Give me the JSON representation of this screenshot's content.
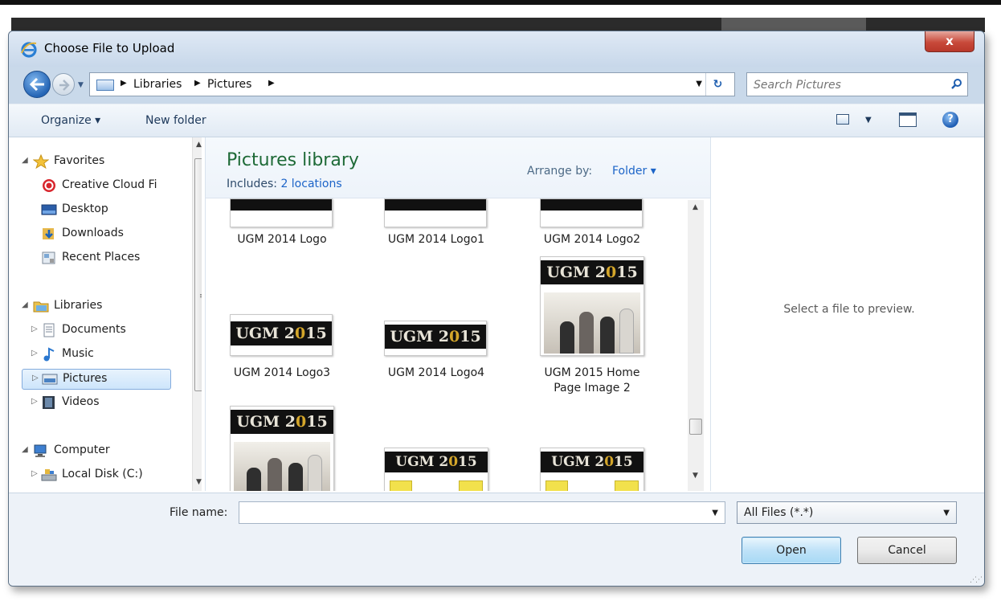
{
  "window": {
    "title": "Choose File to Upload",
    "close_label": "x"
  },
  "address": {
    "crumbs": [
      "Libraries",
      "Pictures"
    ]
  },
  "search": {
    "placeholder": "Search Pictures"
  },
  "toolbar": {
    "organize_label": "Organize ▾",
    "new_folder_label": "New folder"
  },
  "sidebar": {
    "favorites": {
      "label": "Favorites",
      "items": [
        "Creative Cloud Fi",
        "Desktop",
        "Downloads",
        "Recent Places"
      ]
    },
    "libraries": {
      "label": "Libraries",
      "items": [
        "Documents",
        "Music",
        "Pictures",
        "Videos"
      ],
      "selected": "Pictures"
    },
    "computer": {
      "label": "Computer",
      "items": [
        "Local Disk (C:)"
      ]
    }
  },
  "library": {
    "title": "Pictures library",
    "includes_label": "Includes:",
    "locations_link": "2 locations",
    "arrange_label": "Arrange by:",
    "arrange_value": "Folder ▾"
  },
  "files": [
    {
      "name": "UGM 2014 Logo"
    },
    {
      "name": "UGM 2014 Logo1"
    },
    {
      "name": "UGM 2014 Logo2"
    },
    {
      "name": "UGM 2014 Logo3"
    },
    {
      "name": "UGM 2014 Logo4"
    },
    {
      "name": "UGM 2015 Home Page Image 2"
    }
  ],
  "thumb_text": {
    "banner_left": "UGM 2",
    "banner_gold": "0",
    "banner_right": "15"
  },
  "preview": {
    "message": "Select a file to preview."
  },
  "bottom": {
    "filename_label": "File name:",
    "filename_value": "",
    "filetype_value": "All Files (*.*)",
    "open_label": "Open",
    "cancel_label": "Cancel"
  },
  "colors": {
    "library_title": "#1e6a37",
    "link": "#1c64c8",
    "close_button": "#c8493a"
  },
  "icons": [
    "ie-icon",
    "back-arrow-icon",
    "forward-arrow-icon",
    "folder-icon",
    "refresh-icon",
    "search-icon",
    "view-icon",
    "preview-pane-icon",
    "help-icon",
    "star-icon",
    "creative-cloud-icon",
    "desktop-icon",
    "downloads-icon",
    "recent-places-icon",
    "libraries-icon",
    "documents-icon",
    "music-icon",
    "pictures-icon",
    "videos-icon",
    "computer-icon",
    "disk-icon"
  ]
}
